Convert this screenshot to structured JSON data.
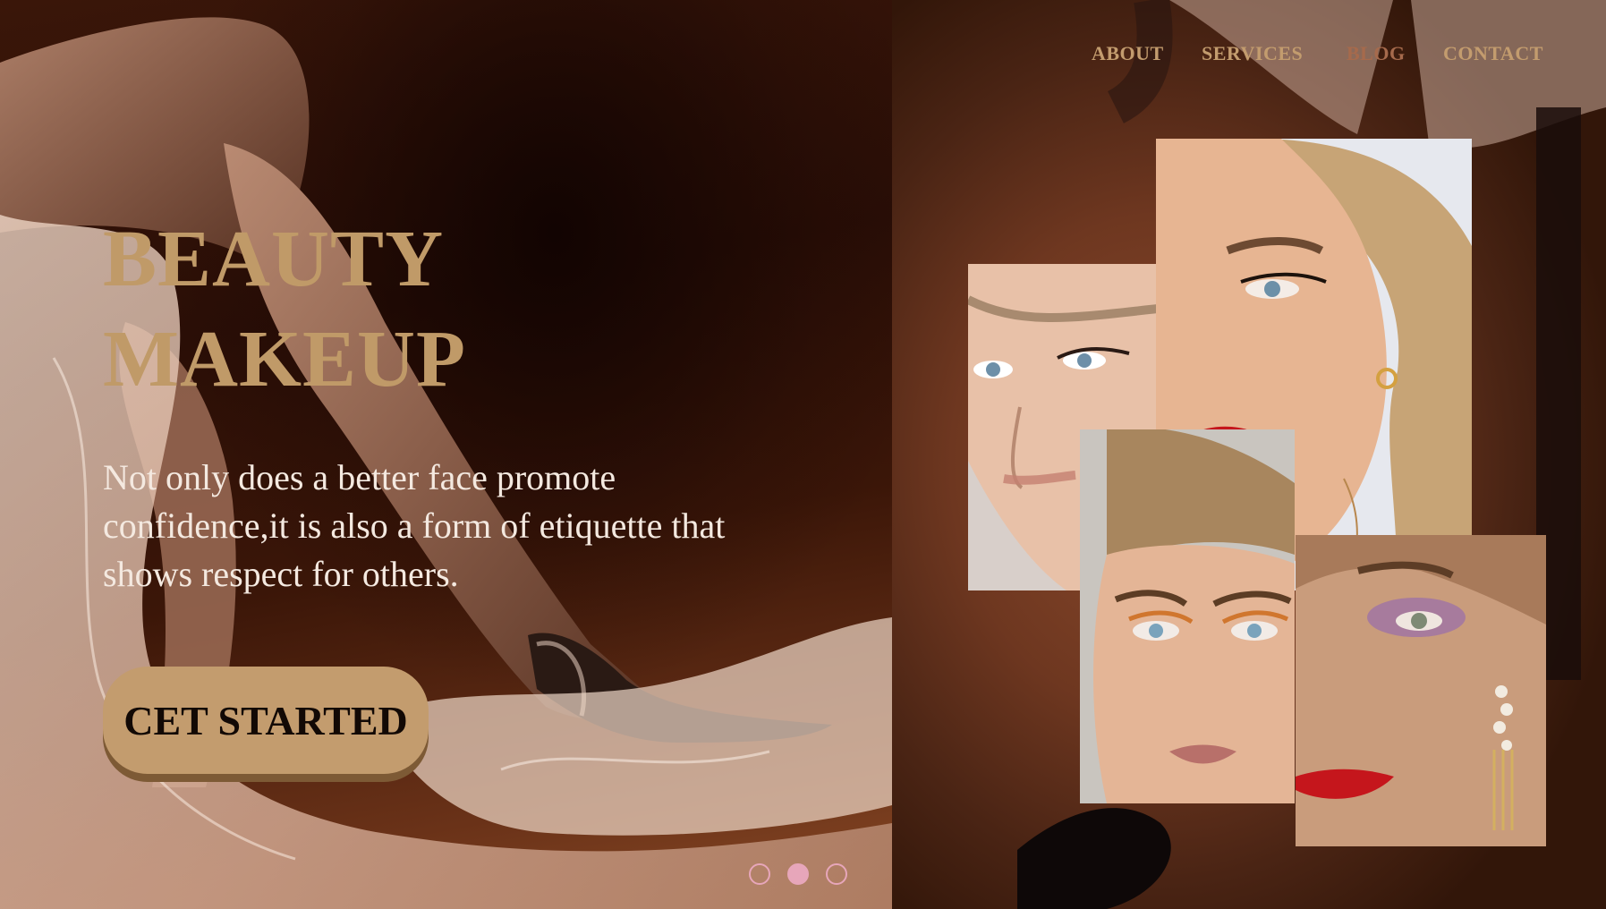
{
  "hero": {
    "title_line1": "BEAUTY",
    "title_line2": "MAKEUP",
    "description": "Not only does a better face promote confidence,it is also a form of etiquette that shows respect for others.",
    "cta_label": "CET STARTED"
  },
  "nav": {
    "items": [
      {
        "label": "ABOUT"
      },
      {
        "label": "SERVICES"
      },
      {
        "label": "BLOG"
      },
      {
        "label": "CONTACT"
      }
    ]
  },
  "pager": {
    "total": 3,
    "active_index": 1
  },
  "colors": {
    "accent_gold": "#c39c6e",
    "dark_brown": "#1e0c06",
    "pager_pink": "#e7a6ba",
    "lip_red": "#c5161c"
  },
  "gallery": {
    "photos": [
      {
        "name": "model-photo-blue-eyes"
      },
      {
        "name": "model-photo-red-lips"
      },
      {
        "name": "model-photo-orange-liner"
      },
      {
        "name": "model-photo-purple-shadow"
      }
    ]
  }
}
